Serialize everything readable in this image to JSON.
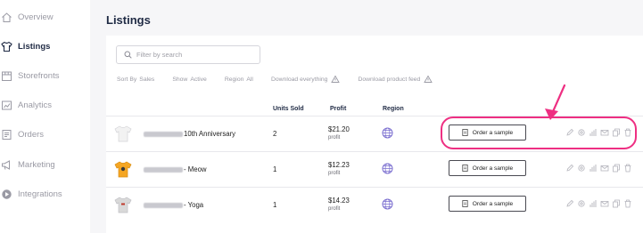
{
  "sidebar": {
    "items": [
      {
        "label": "Overview",
        "icon": "home-icon",
        "active": false
      },
      {
        "label": "Listings",
        "icon": "shirt-icon",
        "active": true
      },
      {
        "label": "Storefronts",
        "icon": "storefront-icon",
        "active": false
      },
      {
        "label": "Analytics",
        "icon": "analytics-icon",
        "active": false
      },
      {
        "label": "Orders",
        "icon": "orders-icon",
        "active": false
      },
      {
        "label": "Marketing",
        "icon": "megaphone-icon",
        "active": false
      },
      {
        "label": "Integrations",
        "icon": "integrations-icon",
        "active": false
      }
    ]
  },
  "page": {
    "title": "Listings"
  },
  "search": {
    "placeholder": "Filter by search"
  },
  "filters": {
    "sort_label": "Sort By",
    "sort_value": "Sales",
    "show_label": "Show",
    "show_value": "Active",
    "region_label": "Region",
    "region_value": "All",
    "download_everything": "Download everything",
    "download_feed": "Download product feed"
  },
  "table": {
    "headers": {
      "units": "Units Sold",
      "profit": "Profit",
      "region": "Region"
    },
    "order_button_label": "Order a sample",
    "profit_sublabel": "profit",
    "rows": [
      {
        "name_suffix": "10th Anniversary",
        "units": "2",
        "profit": "$21.20",
        "shirt_color": "#f2f2f2"
      },
      {
        "name_suffix": " - Meow",
        "units": "1",
        "profit": "$12.23",
        "shirt_color": "#f5a623"
      },
      {
        "name_suffix": " - Yoga",
        "units": "1",
        "profit": "$14.23",
        "shirt_color": "#d9d9d9"
      }
    ]
  },
  "colors": {
    "accent": "#ee2f82",
    "navy": "#1f2a44",
    "globe": "#7b6fd0"
  }
}
